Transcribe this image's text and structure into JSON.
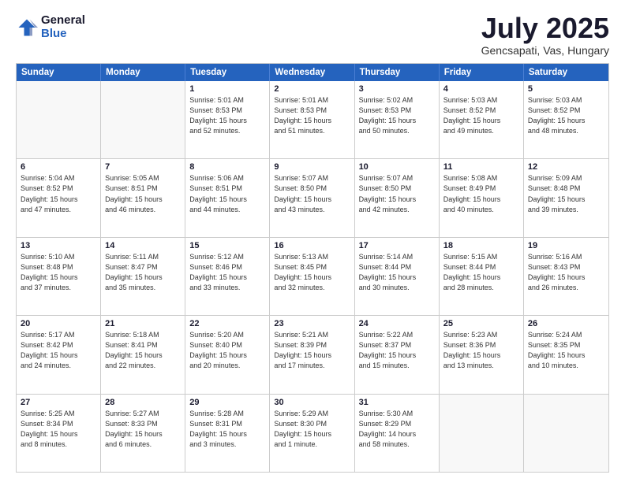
{
  "logo": {
    "general": "General",
    "blue": "Blue"
  },
  "header": {
    "month": "July 2025",
    "location": "Gencsapati, Vas, Hungary"
  },
  "weekdays": [
    "Sunday",
    "Monday",
    "Tuesday",
    "Wednesday",
    "Thursday",
    "Friday",
    "Saturday"
  ],
  "weeks": [
    [
      {
        "day": "",
        "info": ""
      },
      {
        "day": "",
        "info": ""
      },
      {
        "day": "1",
        "info": "Sunrise: 5:01 AM\nSunset: 8:53 PM\nDaylight: 15 hours\nand 52 minutes."
      },
      {
        "day": "2",
        "info": "Sunrise: 5:01 AM\nSunset: 8:53 PM\nDaylight: 15 hours\nand 51 minutes."
      },
      {
        "day": "3",
        "info": "Sunrise: 5:02 AM\nSunset: 8:53 PM\nDaylight: 15 hours\nand 50 minutes."
      },
      {
        "day": "4",
        "info": "Sunrise: 5:03 AM\nSunset: 8:52 PM\nDaylight: 15 hours\nand 49 minutes."
      },
      {
        "day": "5",
        "info": "Sunrise: 5:03 AM\nSunset: 8:52 PM\nDaylight: 15 hours\nand 48 minutes."
      }
    ],
    [
      {
        "day": "6",
        "info": "Sunrise: 5:04 AM\nSunset: 8:52 PM\nDaylight: 15 hours\nand 47 minutes."
      },
      {
        "day": "7",
        "info": "Sunrise: 5:05 AM\nSunset: 8:51 PM\nDaylight: 15 hours\nand 46 minutes."
      },
      {
        "day": "8",
        "info": "Sunrise: 5:06 AM\nSunset: 8:51 PM\nDaylight: 15 hours\nand 44 minutes."
      },
      {
        "day": "9",
        "info": "Sunrise: 5:07 AM\nSunset: 8:50 PM\nDaylight: 15 hours\nand 43 minutes."
      },
      {
        "day": "10",
        "info": "Sunrise: 5:07 AM\nSunset: 8:50 PM\nDaylight: 15 hours\nand 42 minutes."
      },
      {
        "day": "11",
        "info": "Sunrise: 5:08 AM\nSunset: 8:49 PM\nDaylight: 15 hours\nand 40 minutes."
      },
      {
        "day": "12",
        "info": "Sunrise: 5:09 AM\nSunset: 8:48 PM\nDaylight: 15 hours\nand 39 minutes."
      }
    ],
    [
      {
        "day": "13",
        "info": "Sunrise: 5:10 AM\nSunset: 8:48 PM\nDaylight: 15 hours\nand 37 minutes."
      },
      {
        "day": "14",
        "info": "Sunrise: 5:11 AM\nSunset: 8:47 PM\nDaylight: 15 hours\nand 35 minutes."
      },
      {
        "day": "15",
        "info": "Sunrise: 5:12 AM\nSunset: 8:46 PM\nDaylight: 15 hours\nand 33 minutes."
      },
      {
        "day": "16",
        "info": "Sunrise: 5:13 AM\nSunset: 8:45 PM\nDaylight: 15 hours\nand 32 minutes."
      },
      {
        "day": "17",
        "info": "Sunrise: 5:14 AM\nSunset: 8:44 PM\nDaylight: 15 hours\nand 30 minutes."
      },
      {
        "day": "18",
        "info": "Sunrise: 5:15 AM\nSunset: 8:44 PM\nDaylight: 15 hours\nand 28 minutes."
      },
      {
        "day": "19",
        "info": "Sunrise: 5:16 AM\nSunset: 8:43 PM\nDaylight: 15 hours\nand 26 minutes."
      }
    ],
    [
      {
        "day": "20",
        "info": "Sunrise: 5:17 AM\nSunset: 8:42 PM\nDaylight: 15 hours\nand 24 minutes."
      },
      {
        "day": "21",
        "info": "Sunrise: 5:18 AM\nSunset: 8:41 PM\nDaylight: 15 hours\nand 22 minutes."
      },
      {
        "day": "22",
        "info": "Sunrise: 5:20 AM\nSunset: 8:40 PM\nDaylight: 15 hours\nand 20 minutes."
      },
      {
        "day": "23",
        "info": "Sunrise: 5:21 AM\nSunset: 8:39 PM\nDaylight: 15 hours\nand 17 minutes."
      },
      {
        "day": "24",
        "info": "Sunrise: 5:22 AM\nSunset: 8:37 PM\nDaylight: 15 hours\nand 15 minutes."
      },
      {
        "day": "25",
        "info": "Sunrise: 5:23 AM\nSunset: 8:36 PM\nDaylight: 15 hours\nand 13 minutes."
      },
      {
        "day": "26",
        "info": "Sunrise: 5:24 AM\nSunset: 8:35 PM\nDaylight: 15 hours\nand 10 minutes."
      }
    ],
    [
      {
        "day": "27",
        "info": "Sunrise: 5:25 AM\nSunset: 8:34 PM\nDaylight: 15 hours\nand 8 minutes."
      },
      {
        "day": "28",
        "info": "Sunrise: 5:27 AM\nSunset: 8:33 PM\nDaylight: 15 hours\nand 6 minutes."
      },
      {
        "day": "29",
        "info": "Sunrise: 5:28 AM\nSunset: 8:31 PM\nDaylight: 15 hours\nand 3 minutes."
      },
      {
        "day": "30",
        "info": "Sunrise: 5:29 AM\nSunset: 8:30 PM\nDaylight: 15 hours\nand 1 minute."
      },
      {
        "day": "31",
        "info": "Sunrise: 5:30 AM\nSunset: 8:29 PM\nDaylight: 14 hours\nand 58 minutes."
      },
      {
        "day": "",
        "info": ""
      },
      {
        "day": "",
        "info": ""
      }
    ]
  ]
}
